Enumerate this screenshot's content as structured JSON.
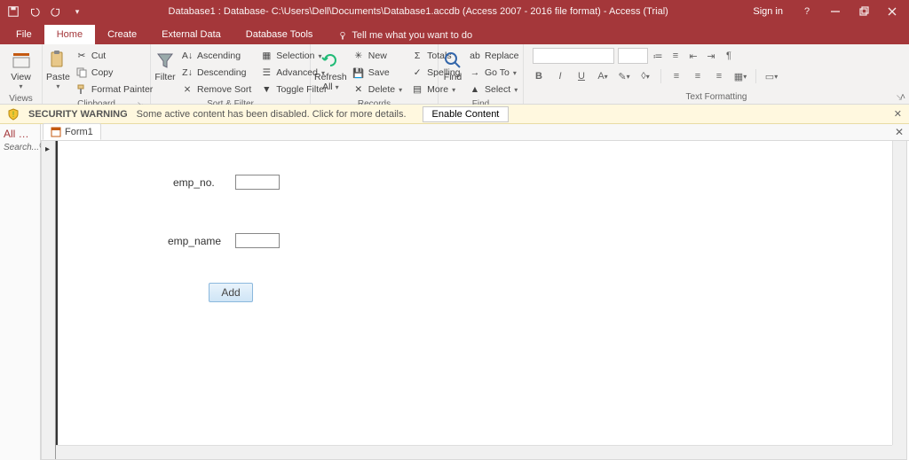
{
  "titlebar": {
    "title": "Database1 : Database- C:\\Users\\Dell\\Documents\\Database1.accdb (Access 2007 - 2016 file format) - Access (Trial)",
    "signin": "Sign in"
  },
  "tabs": {
    "file": "File",
    "home": "Home",
    "create": "Create",
    "external": "External Data",
    "dbtools": "Database Tools",
    "tellme": "Tell me what you want to do"
  },
  "ribbon": {
    "views": {
      "view": "View",
      "label": "Views"
    },
    "clipboard": {
      "paste": "Paste",
      "cut": "Cut",
      "copy": "Copy",
      "painter": "Format Painter",
      "label": "Clipboard"
    },
    "sort": {
      "filter": "Filter",
      "asc": "Ascending",
      "desc": "Descending",
      "remove": "Remove Sort",
      "selection": "Selection",
      "advanced": "Advanced",
      "toggle": "Toggle Filter",
      "label": "Sort & Filter"
    },
    "records": {
      "refresh": "Refresh",
      "refresh2": "All",
      "new": "New",
      "save": "Save",
      "delete": "Delete",
      "totals": "Totals",
      "spelling": "Spelling",
      "more": "More",
      "label": "Records"
    },
    "find": {
      "find": "Find",
      "replace": "Replace",
      "goto": "Go To",
      "select": "Select",
      "label": "Find"
    },
    "text": {
      "label": "Text Formatting"
    }
  },
  "security": {
    "heading": "SECURITY WARNING",
    "msg": "Some active content has been disabled. Click for more details.",
    "button": "Enable Content"
  },
  "nav": {
    "heading": "All …",
    "search": "Search..."
  },
  "doc": {
    "tab": "Form1",
    "fields": {
      "emp_no_label": "emp_no.",
      "emp_name_label": "emp_name",
      "add_button": "Add"
    }
  }
}
